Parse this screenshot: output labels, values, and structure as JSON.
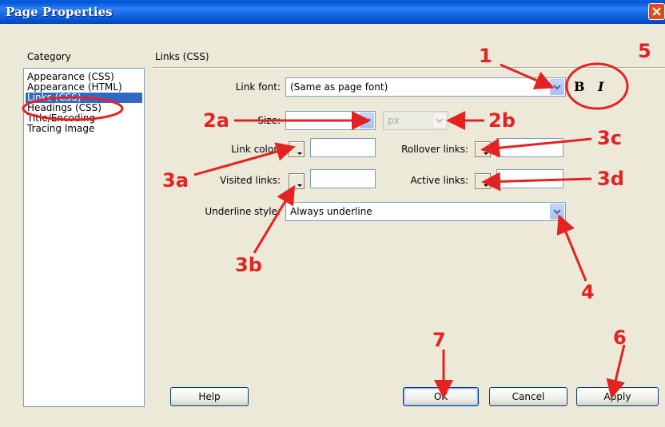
{
  "window": {
    "title": "Page Properties"
  },
  "category": {
    "label": "Category",
    "items": [
      "Appearance (CSS)",
      "Appearance (HTML)",
      "Links (CSS)",
      "Headings (CSS)",
      "Title/Encoding",
      "Tracing Image"
    ],
    "selected": "Links (CSS)"
  },
  "section": {
    "title": "Links (CSS)"
  },
  "form": {
    "link_font_label": "Link font:",
    "link_font_value": "(Same as page font)",
    "bold_label": "B",
    "italic_label": "I",
    "size_label": "Size:",
    "size_value": "",
    "size_unit": "px",
    "link_color_label": "Link color:",
    "link_color_value": "",
    "visited_links_label": "Visited links:",
    "visited_links_value": "",
    "rollover_links_label": "Rollover links:",
    "rollover_links_value": "",
    "active_links_label": "Active links:",
    "active_links_value": "",
    "underline_style_label": "Underline style:",
    "underline_style_value": "Always underline"
  },
  "buttons": {
    "help": "Help",
    "ok": "OK",
    "cancel": "Cancel",
    "apply": "Apply"
  },
  "annotations": {
    "a1": "1",
    "a2a": "2a",
    "a2b": "2b",
    "a3a": "3a",
    "a3b": "3b",
    "a3c": "3c",
    "a3d": "3d",
    "a4": "4",
    "a5": "5",
    "a6": "6",
    "a7": "7",
    "color": "#e52222"
  },
  "colors": {
    "titlebar": "#0a5fd8",
    "selection": "#316ac5",
    "dialog_bg": "#ece9d8"
  }
}
